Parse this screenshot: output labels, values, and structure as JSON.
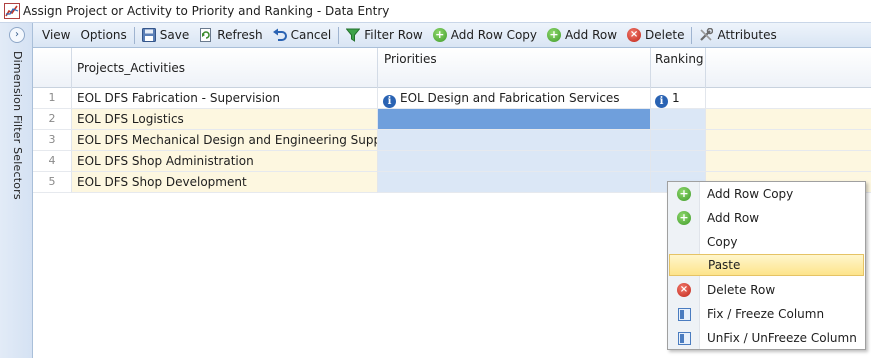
{
  "window": {
    "title": "Assign Project or Activity to Priority and Ranking - Data Entry"
  },
  "leftbar": {
    "label": "Dimension Filter Selectors",
    "expand_glyph": "›"
  },
  "toolbar": {
    "view": "View",
    "options": "Options",
    "save": "Save",
    "refresh": "Refresh",
    "cancel": "Cancel",
    "filter_row": "Filter Row",
    "add_row_copy": "Add Row Copy",
    "add_row": "Add Row",
    "delete": "Delete",
    "attributes": "Attributes"
  },
  "grid": {
    "columns": [
      "Projects_Activities",
      "Priorities",
      "Ranking"
    ],
    "rows": [
      {
        "num": "1",
        "project": "EOL DFS Fabrication - Supervision",
        "priority": "EOL Design and Fabrication Services",
        "ranking": "1"
      },
      {
        "num": "2",
        "project": "EOL DFS Logistics",
        "priority": "",
        "ranking": ""
      },
      {
        "num": "3",
        "project": "EOL DFS Mechanical Design and Engineering Support",
        "priority": "",
        "ranking": ""
      },
      {
        "num": "4",
        "project": "EOL DFS Shop Administration",
        "priority": "",
        "ranking": ""
      },
      {
        "num": "5",
        "project": "EOL DFS Shop Development",
        "priority": "",
        "ranking": ""
      }
    ]
  },
  "context_menu": {
    "items": [
      {
        "label": "Add Row Copy",
        "icon": "add-icon"
      },
      {
        "label": "Add Row",
        "icon": "add-icon"
      },
      {
        "label": "Copy",
        "icon": ""
      },
      {
        "label": "Paste",
        "icon": ""
      },
      {
        "label": "Delete Row",
        "icon": "delete-icon"
      },
      {
        "label": "Fix / Freeze Column",
        "icon": "column-icon"
      },
      {
        "label": "UnFix / UnFreeze Column",
        "icon": "column-icon"
      }
    ],
    "highlighted": "Paste"
  },
  "colors": {
    "selected_cell": "#6f9fdc",
    "editable_row": "#fdf7e0",
    "editable_col": "#dbe7f6",
    "menu_highlight": "#fde48b"
  }
}
